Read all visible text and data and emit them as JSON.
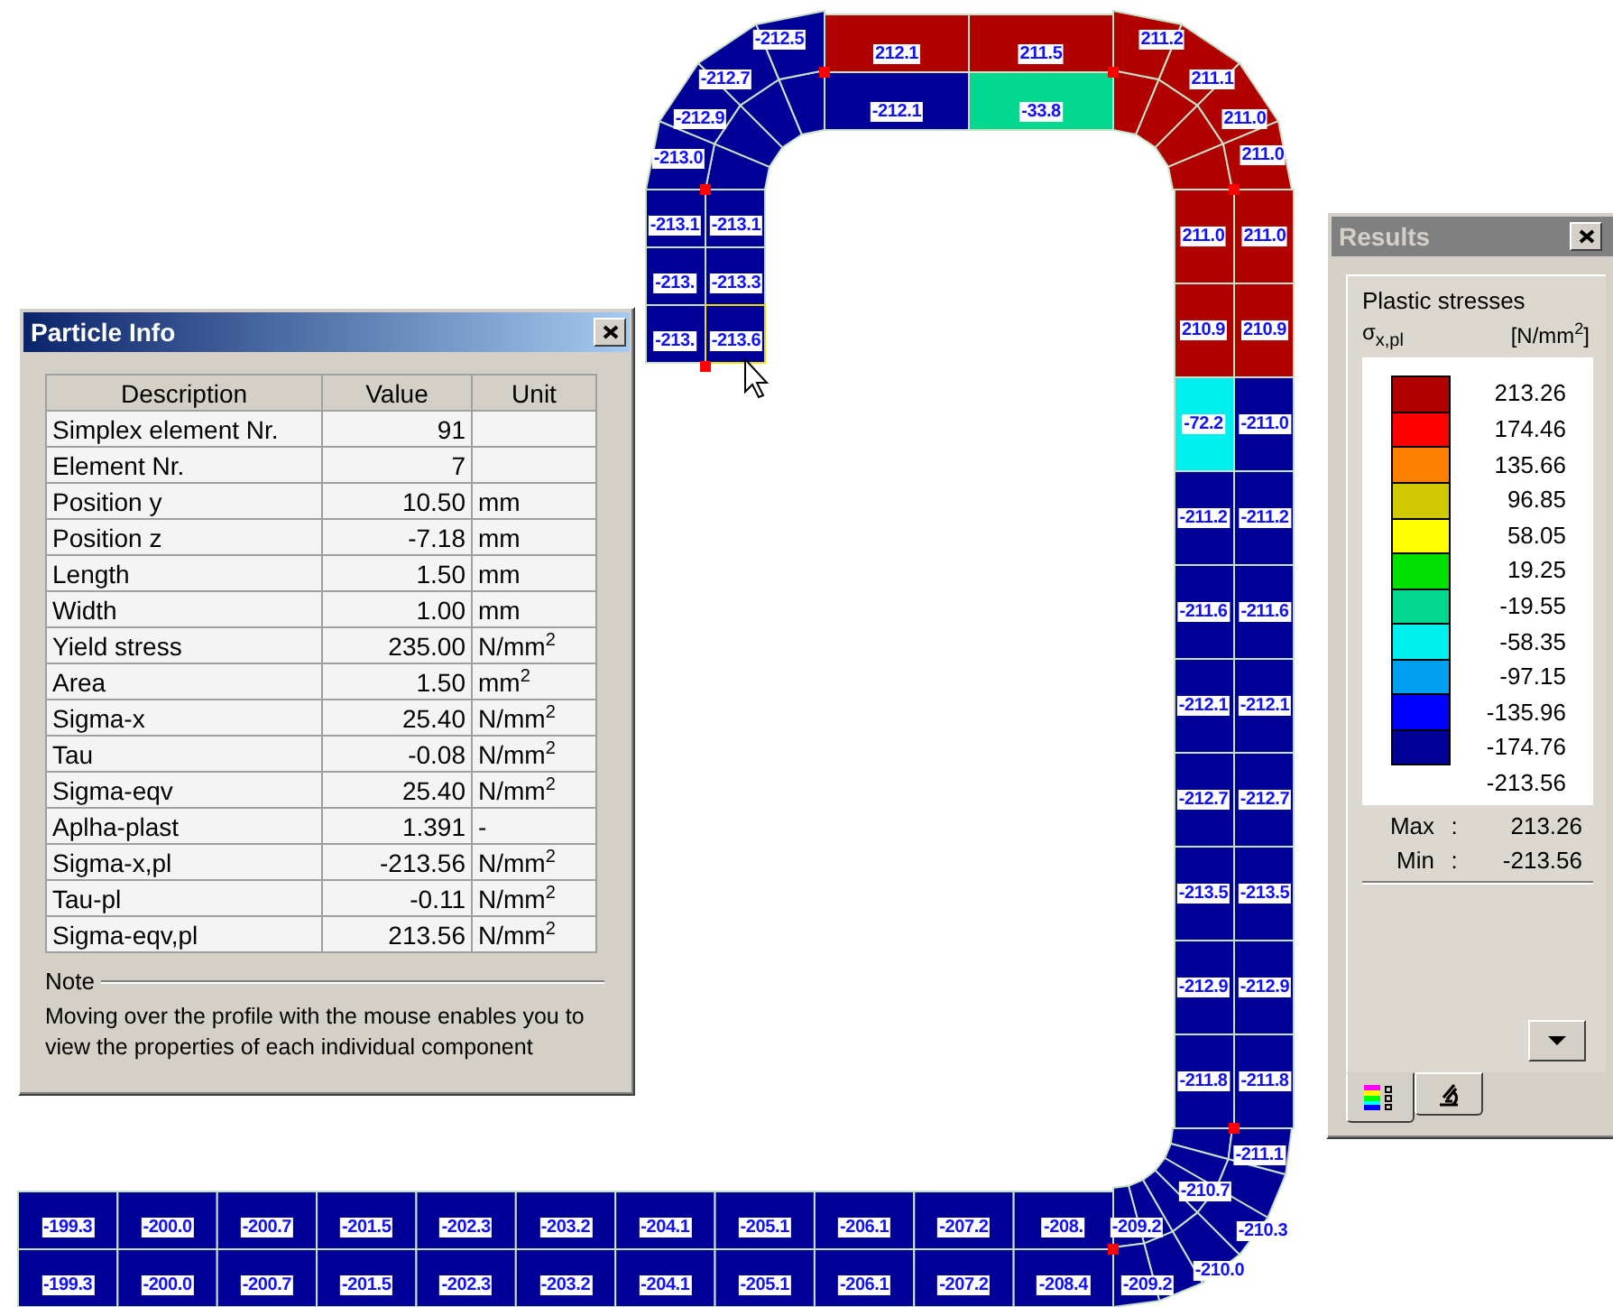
{
  "profile": {
    "top_flange": [
      {
        "outer": {
          "label": "212.1",
          "color": "#b00000"
        },
        "inner": {
          "label": "-212.1",
          "color": "#000098"
        }
      },
      {
        "outer": {
          "label": "211.5",
          "color": "#b00000"
        },
        "inner": {
          "label": "-33.8",
          "color": "#00d890"
        }
      }
    ],
    "left_lip": [
      {
        "left": {
          "label": "-213.1",
          "color": "#000098"
        },
        "right": {
          "label": "-213.1",
          "color": "#000098"
        }
      },
      {
        "left": {
          "label": "-213.",
          "color": "#000098"
        },
        "right": {
          "label": "-213.3",
          "color": "#000098"
        }
      },
      {
        "left": {
          "label": "-213.",
          "color": "#000098"
        },
        "right": {
          "label": "-213.6",
          "color": "#000098"
        }
      }
    ],
    "right_web": [
      {
        "left": {
          "label": "211.0",
          "color": "#b00000"
        },
        "right": {
          "label": "211.0",
          "color": "#b00000"
        }
      },
      {
        "left": {
          "label": "210.9",
          "color": "#b00000"
        },
        "right": {
          "label": "210.9",
          "color": "#b00000"
        }
      },
      {
        "left": {
          "label": "-72.2",
          "color": "#00f0f0"
        },
        "right": {
          "label": "-211.0",
          "color": "#000098"
        }
      },
      {
        "left": {
          "label": "-211.2",
          "color": "#000098"
        },
        "right": {
          "label": "-211.2",
          "color": "#000098"
        }
      },
      {
        "left": {
          "label": "-211.6",
          "color": "#000098"
        },
        "right": {
          "label": "-211.6",
          "color": "#000098"
        }
      },
      {
        "left": {
          "label": "-212.1",
          "color": "#000098"
        },
        "right": {
          "label": "-212.1",
          "color": "#000098"
        }
      },
      {
        "left": {
          "label": "-212.7",
          "color": "#000098"
        },
        "right": {
          "label": "-212.7",
          "color": "#000098"
        }
      },
      {
        "left": {
          "label": "-213.5",
          "color": "#000098"
        },
        "right": {
          "label": "-213.5",
          "color": "#000098"
        }
      },
      {
        "left": {
          "label": "-212.9",
          "color": "#000098"
        },
        "right": {
          "label": "-212.9",
          "color": "#000098"
        }
      },
      {
        "left": {
          "label": "-211.8",
          "color": "#000098"
        },
        "right": {
          "label": "-211.8",
          "color": "#000098"
        }
      }
    ],
    "bottom_flange": [
      {
        "top": {
          "label": "-199.3",
          "color": "#000098"
        },
        "bottom": {
          "label": "-199.3",
          "color": "#000098"
        }
      },
      {
        "top": {
          "label": "-200.0",
          "color": "#000098"
        },
        "bottom": {
          "label": "-200.0",
          "color": "#000098"
        }
      },
      {
        "top": {
          "label": "-200.7",
          "color": "#000098"
        },
        "bottom": {
          "label": "-200.7",
          "color": "#000098"
        }
      },
      {
        "top": {
          "label": "-201.5",
          "color": "#000098"
        },
        "bottom": {
          "label": "-201.5",
          "color": "#000098"
        }
      },
      {
        "top": {
          "label": "-202.3",
          "color": "#000098"
        },
        "bottom": {
          "label": "-202.3",
          "color": "#000098"
        }
      },
      {
        "top": {
          "label": "-203.2",
          "color": "#000098"
        },
        "bottom": {
          "label": "-203.2",
          "color": "#000098"
        }
      },
      {
        "top": {
          "label": "-204.1",
          "color": "#000098"
        },
        "bottom": {
          "label": "-204.1",
          "color": "#000098"
        }
      },
      {
        "top": {
          "label": "-205.1",
          "color": "#000098"
        },
        "bottom": {
          "label": "-205.1",
          "color": "#000098"
        }
      },
      {
        "top": {
          "label": "-206.1",
          "color": "#000098"
        },
        "bottom": {
          "label": "-206.1",
          "color": "#000098"
        }
      },
      {
        "top": {
          "label": "-207.2",
          "color": "#000098"
        },
        "bottom": {
          "label": "-207.2",
          "color": "#000098"
        }
      },
      {
        "top": {
          "label": "-208.",
          "color": "#000098"
        },
        "bottom": {
          "label": "-208.4",
          "color": "#000098"
        }
      }
    ],
    "corners": [
      {
        "color": "#000098",
        "labels": [
          "-212.5",
          "-212.7",
          "-212.9",
          "-213.0"
        ]
      },
      {
        "color": "#b00000",
        "labels": [
          "211.2",
          "211.1",
          "211.0",
          "211.0"
        ]
      },
      {
        "color": "#000098",
        "labels": [
          "-211.1",
          "-210.7",
          "-210.3",
          "-210.0",
          "-209.2",
          "-209.2"
        ]
      }
    ]
  },
  "particle_info": {
    "title": "Particle Info",
    "columns": [
      "Description",
      "Value",
      "Unit"
    ],
    "rows": [
      [
        "Simplex element Nr.",
        "91",
        ""
      ],
      [
        "Element Nr.",
        "7",
        ""
      ],
      [
        "Position y",
        "10.50",
        "mm"
      ],
      [
        "Position z",
        "-7.18",
        "mm"
      ],
      [
        "Length",
        "1.50",
        "mm"
      ],
      [
        "Width",
        "1.00",
        "mm"
      ],
      [
        "Yield stress",
        "235.00",
        "N/mm$^{2}$"
      ],
      [
        "Area",
        "1.50",
        "mm$^{2}$"
      ],
      [
        "Sigma-x",
        "25.40",
        "N/mm$^{2}$"
      ],
      [
        "Tau",
        "-0.08",
        "N/mm$^{2}$"
      ],
      [
        "Sigma-eqv",
        "25.40",
        "N/mm$^{2}$"
      ],
      [
        "Aplha-plast",
        "1.391",
        "-"
      ],
      [
        "Sigma-x,pl",
        "-213.56",
        "N/mm$^{2}$"
      ],
      [
        "Tau-pl",
        "-0.11",
        "N/mm$^{2}$"
      ],
      [
        "Sigma-eqv,pl",
        "213.56",
        "N/mm$^{2}$"
      ]
    ],
    "note_label": "Note",
    "note_text": "Moving over the profile with the mouse enables you to view the properties of each individual component"
  },
  "results": {
    "title": "Results",
    "heading": "Plastic stresses",
    "symbol": "σ$_{x,pl}$",
    "unit": "[N/mm$^{2}$]",
    "legend": [
      {
        "value": "213.26",
        "color": "#b00000"
      },
      {
        "value": "174.46",
        "color": "#ff0000"
      },
      {
        "value": "135.66",
        "color": "#ff8000"
      },
      {
        "value": "96.85",
        "color": "#d0c800"
      },
      {
        "value": "58.05",
        "color": "#ffff00"
      },
      {
        "value": "19.25",
        "color": "#00e000"
      },
      {
        "value": "-19.55",
        "color": "#00d890"
      },
      {
        "value": "-58.35",
        "color": "#00f0f0"
      },
      {
        "value": "-97.15",
        "color": "#00a0f0"
      },
      {
        "value": "-135.96",
        "color": "#0000ff"
      },
      {
        "value": "-174.76",
        "color": "#000098"
      },
      {
        "value": "-213.56"
      }
    ],
    "max_label": "Max",
    "max_separator": ":",
    "max_value": "213.26",
    "min_label": "Min",
    "min_separator": ":",
    "min_value": "-213.56",
    "tabs": [
      {
        "kind": "legend",
        "selected": true
      },
      {
        "kind": "tools",
        "selected": false
      }
    ]
  }
}
